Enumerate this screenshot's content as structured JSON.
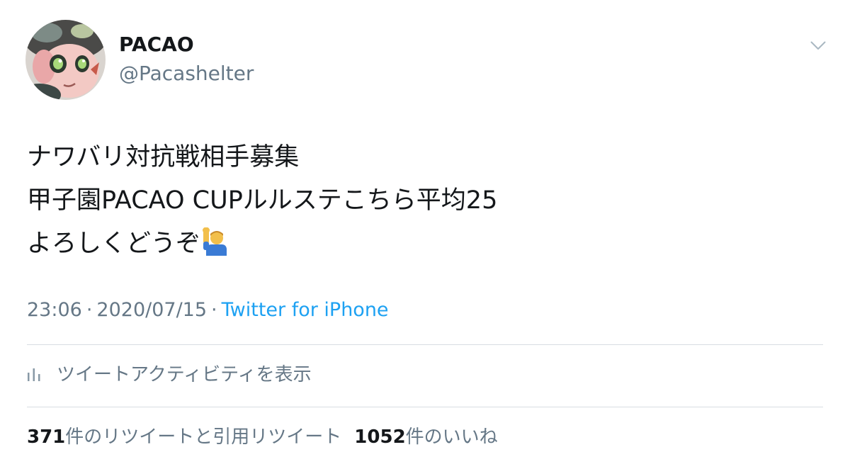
{
  "author": {
    "display_name": "PACAO",
    "handle": "@Pacashelter"
  },
  "tweet": {
    "lines": [
      "ナワバリ対抗戦相手募集",
      "甲子園PACAO CUPルルステこちら平均25",
      "よろしくどうぞ"
    ],
    "emoji": "man-raising-hand-emoji"
  },
  "meta": {
    "time": "23:06",
    "separator": "·",
    "date": "2020/07/15",
    "source": "Twitter for iPhone"
  },
  "activity": {
    "label": "ツイートアクティビティを表示",
    "icon": "bar-chart-icon"
  },
  "stats": {
    "retweets_count": "371",
    "retweets_label": "件のリツイートと引用リツイート",
    "likes_count": "1052",
    "likes_label": "件のいいね"
  },
  "colors": {
    "text": "#14171a",
    "secondary": "#657786",
    "link": "#1da1f2",
    "divider": "#d8dde2"
  }
}
